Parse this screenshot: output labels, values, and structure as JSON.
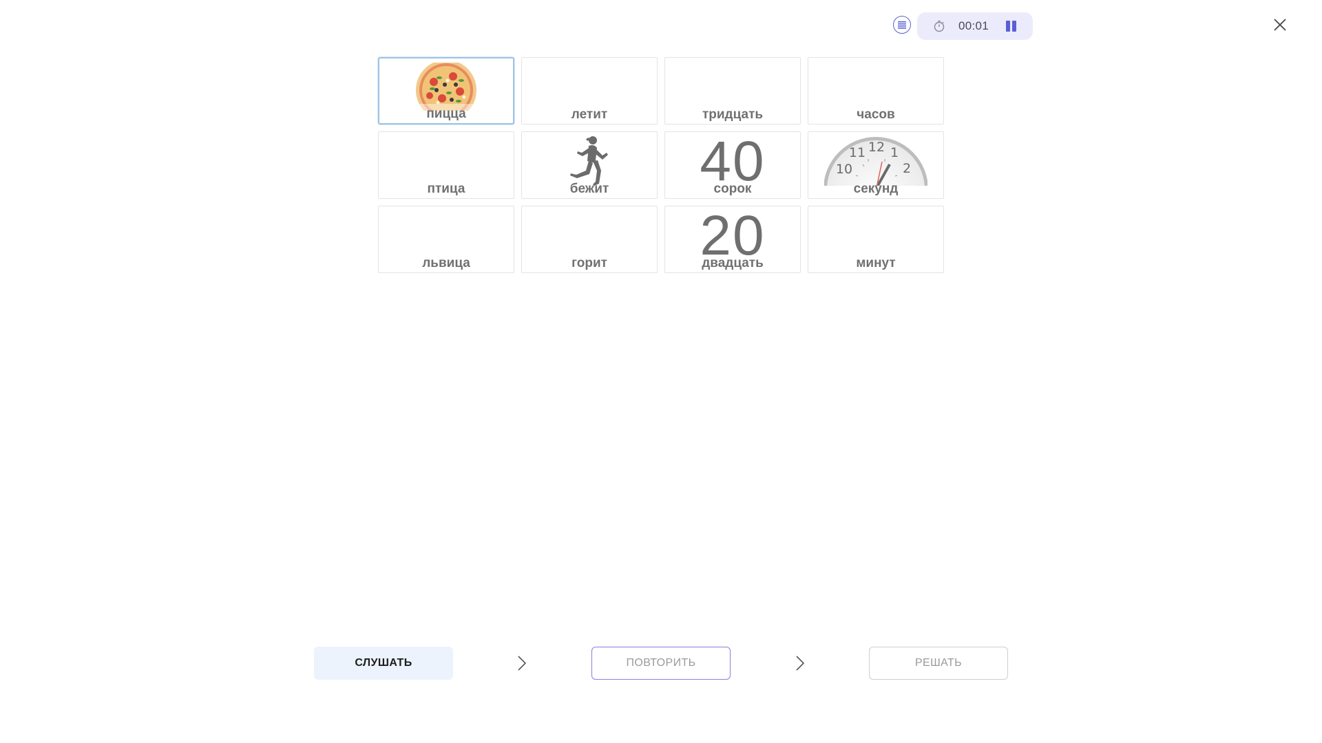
{
  "header": {
    "timer": "00:01",
    "icons": {
      "list": "list-icon",
      "timer": "stopwatch-icon",
      "pause": "pause-icon",
      "close": "close-icon"
    },
    "accent_color": "#5b5fd6"
  },
  "cards": [
    {
      "word": "пицца",
      "image": "pizza",
      "selected": true
    },
    {
      "word": "летит",
      "image": ""
    },
    {
      "word": "тридцать",
      "image": ""
    },
    {
      "word": "часов",
      "image": ""
    },
    {
      "word": "птица",
      "image": ""
    },
    {
      "word": "бежит",
      "image": "runner"
    },
    {
      "word": "сорок",
      "image": "number",
      "number": "40"
    },
    {
      "word": "секунд",
      "image": "clock-face",
      "clock_numbers": [
        "10",
        "11",
        "12",
        "1",
        "2"
      ]
    },
    {
      "word": "львица",
      "image": ""
    },
    {
      "word": "горит",
      "image": ""
    },
    {
      "word": "двадцать",
      "image": "number",
      "number": "20"
    },
    {
      "word": "минут",
      "image": ""
    }
  ],
  "steps": {
    "listen": "СЛУШАТЬ",
    "repeat": "ПОВТОРИТЬ",
    "solve": "РЕШАТЬ"
  }
}
